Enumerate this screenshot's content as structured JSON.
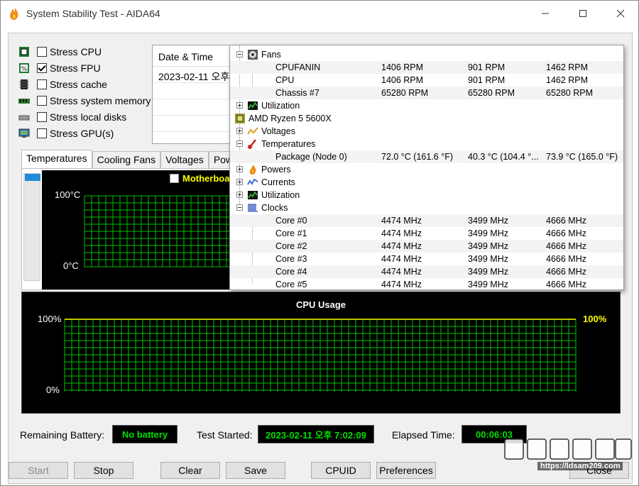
{
  "window": {
    "title": "System Stability Test - AIDA64"
  },
  "stress_options": [
    {
      "label": "Stress CPU",
      "checked": false,
      "icon": "cpu-chip-icon"
    },
    {
      "label": "Stress FPU",
      "checked": true,
      "icon": "fpu-percent-icon"
    },
    {
      "label": "Stress cache",
      "checked": false,
      "icon": "cache-chip-icon"
    },
    {
      "label": "Stress system memory",
      "checked": false,
      "icon": "memory-module-icon"
    },
    {
      "label": "Stress local disks",
      "checked": false,
      "icon": "disk-drive-icon"
    },
    {
      "label": "Stress GPU(s)",
      "checked": false,
      "icon": "gpu-monitor-icon"
    }
  ],
  "log": {
    "header": "Date & Time",
    "rows": [
      "2023-02-11 오후"
    ]
  },
  "tabs": [
    "Temperatures",
    "Cooling Fans",
    "Voltages",
    "Powe"
  ],
  "temp_graph": {
    "legend": "Motherboa",
    "ymax": "100°C",
    "ymin": "0°C"
  },
  "cpu_graph": {
    "title": "CPU Usage",
    "ymax": "100%",
    "ymin": "0%",
    "right_value": "100%"
  },
  "status": {
    "battery_label": "Remaining Battery:",
    "battery_value": "No battery",
    "started_label": "Test Started:",
    "started_value": "2023-02-11 오후 7:02:09",
    "elapsed_label": "Elapsed Time:",
    "elapsed_value": "00:06:03"
  },
  "buttons": {
    "start": "Start",
    "stop": "Stop",
    "clear": "Clear",
    "save": "Save",
    "cpuid": "CPUID",
    "preferences": "Preferences",
    "close": "Close"
  },
  "sensor_tree": {
    "fans": {
      "label": "Fans",
      "rows": [
        {
          "name": "CPUFANIN",
          "cur": "1406 RPM",
          "min": "901 RPM",
          "max": "1462 RPM"
        },
        {
          "name": "CPU",
          "cur": "1406 RPM",
          "min": "901 RPM",
          "max": "1462 RPM"
        },
        {
          "name": "Chassis #7",
          "cur": "65280 RPM",
          "min": "65280 RPM",
          "max": "65280 RPM"
        }
      ]
    },
    "utilization_top": "Utilization",
    "cpu_name": "AMD Ryzen 5 5600X",
    "voltages": "Voltages",
    "temperatures": {
      "label": "Temperatures",
      "rows": [
        {
          "name": "Package (Node 0)",
          "cur": "72.0 °C  (161.6 °F)",
          "min": "40.3 °C  (104.4 °...",
          "max": "73.9 °C  (165.0 °F)"
        }
      ]
    },
    "powers": "Powers",
    "currents": "Currents",
    "utilization": "Utilization",
    "clocks": {
      "label": "Clocks",
      "rows": [
        {
          "name": "Core #0",
          "cur": "4474 MHz",
          "min": "3499 MHz",
          "max": "4666 MHz"
        },
        {
          "name": "Core #1",
          "cur": "4474 MHz",
          "min": "3499 MHz",
          "max": "4666 MHz"
        },
        {
          "name": "Core #2",
          "cur": "4474 MHz",
          "min": "3499 MHz",
          "max": "4666 MHz"
        },
        {
          "name": "Core #3",
          "cur": "4474 MHz",
          "min": "3499 MHz",
          "max": "4666 MHz"
        },
        {
          "name": "Core #4",
          "cur": "4474 MHz",
          "min": "3499 MHz",
          "max": "4666 MHz"
        },
        {
          "name": "Core #5",
          "cur": "4474 MHz",
          "min": "3499 MHz",
          "max": "4666 MHz"
        }
      ]
    }
  },
  "watermark": {
    "url": "https://ldsam209.com"
  },
  "colors": {
    "graph_green": "#00c000",
    "legend_yellow": "#ffff00",
    "status_green": "#00e000",
    "scroll_accent": "#1e8cd8"
  }
}
